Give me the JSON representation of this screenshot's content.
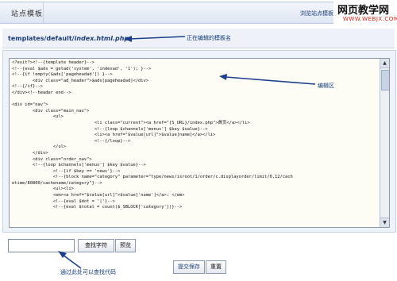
{
  "header": {
    "title": "站点模板",
    "link": "浏览站点模板"
  },
  "watermark": {
    "main": "网页教学网",
    "sub": "WWW.WEBJX.COM"
  },
  "path": {
    "prefix": "templates/default/",
    "file": "index.html.php"
  },
  "annotations": {
    "path": "正在编辑的模板名",
    "editor": "编辑区",
    "search": "通过此处可以查找代码"
  },
  "editor": {
    "code": "<?exit?><!--{template header}-->\n<!--{eval $ads = getad('system', 'indexad', '1'); }-->\n<!--{if !empty($ads['pageheadad']) }-->\n        <div class=\"ad_header\">$ads[pageheadad]</div>\n<!--{/if}-->\n</div><!--header end-->\n\n<div id=\"nav\">\n        <div class=\"main_nav\">\n                <ul>\n                                <li class=\"current\"><a href=\"{S_URL}/index.php\">首页</a></li>\n                                <!--{loop $channels['menus'] $key $value}-->\n                                <li><a href=\"$value[url]\">$value[name]</a></li>\n                                <!--{/loop}-->\n                </ul>\n        </div>\n        <div class=\"order_nav\">\n        <!--{loop $channels['menus'] $key $value}-->\n                <!--{if $key == 'news'}-->\n                <!--{block name=\"category\" parameter=\"type/news/isroot/1/order/c.displayorder/limit/0,12/cach\netime/80800/cachename/category\"}-->\n                <ul><li>\n                <em><a href=\"$value[url]\">$value['name']</a>: </em>\n                <!--{eval $dot = '|'}-->\n                <!--{eval $total = count($_SBLOCK['category'])}-->"
  },
  "buttons": {
    "find": "查找字符",
    "preview": "预览",
    "submit": "提交保存",
    "reset": "重置"
  },
  "colors": {
    "annotation": "#123a7a",
    "arrow": "#1b3f8c",
    "header_bg": "#dde6f2"
  }
}
